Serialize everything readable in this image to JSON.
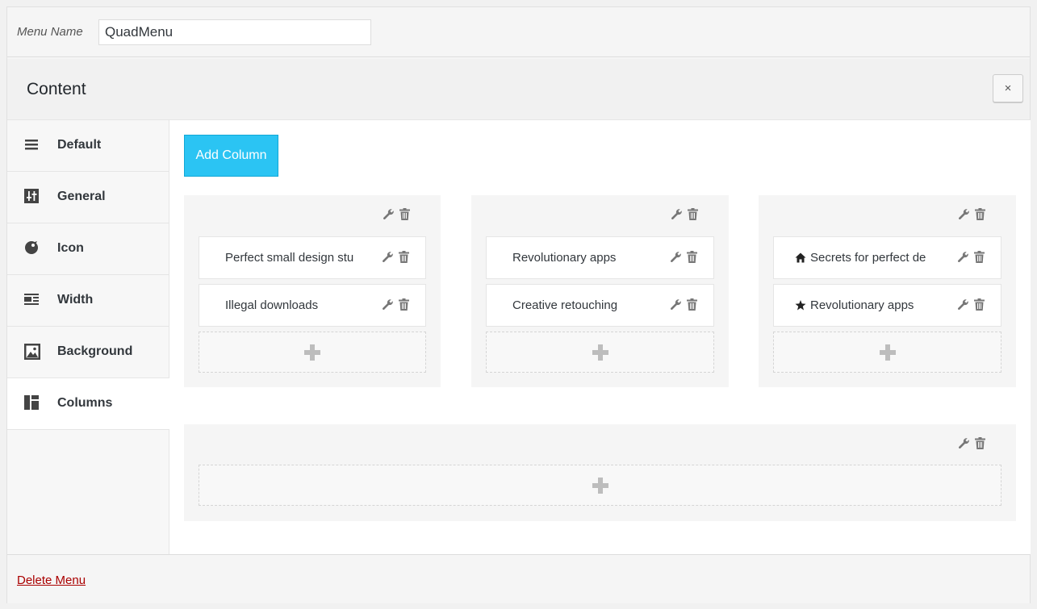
{
  "menu_name": {
    "label": "Menu Name",
    "value": "QuadMenu"
  },
  "content": {
    "title": "Content",
    "close_label": "×"
  },
  "sidebar": {
    "tabs": [
      {
        "label": "Default",
        "icon": "hamburger-icon",
        "active": false
      },
      {
        "label": "General",
        "icon": "sliders-icon",
        "active": false
      },
      {
        "label": "Icon",
        "icon": "palette-icon",
        "active": false
      },
      {
        "label": "Width",
        "icon": "align-icon",
        "active": false
      },
      {
        "label": "Background",
        "icon": "image-icon",
        "active": false
      },
      {
        "label": "Columns",
        "icon": "columns-icon",
        "active": true
      }
    ]
  },
  "main": {
    "add_column_label": "Add Column",
    "accent_color": "#2bc4f3",
    "columns": [
      {
        "items": [
          {
            "label": "Perfect small design stu",
            "icon": null
          },
          {
            "label": "Illegal downloads",
            "icon": null
          }
        ]
      },
      {
        "items": [
          {
            "label": "Revolutionary apps",
            "icon": null
          },
          {
            "label": "Creative retouching",
            "icon": null
          }
        ]
      },
      {
        "items": [
          {
            "label": "Secrets for perfect de",
            "icon": "home-icon"
          },
          {
            "label": "Revolutionary apps",
            "icon": "star-icon"
          }
        ]
      }
    ],
    "wide_column": {
      "items": []
    }
  },
  "footer": {
    "delete_label": "Delete Menu",
    "delete_color": "#aa0000"
  }
}
